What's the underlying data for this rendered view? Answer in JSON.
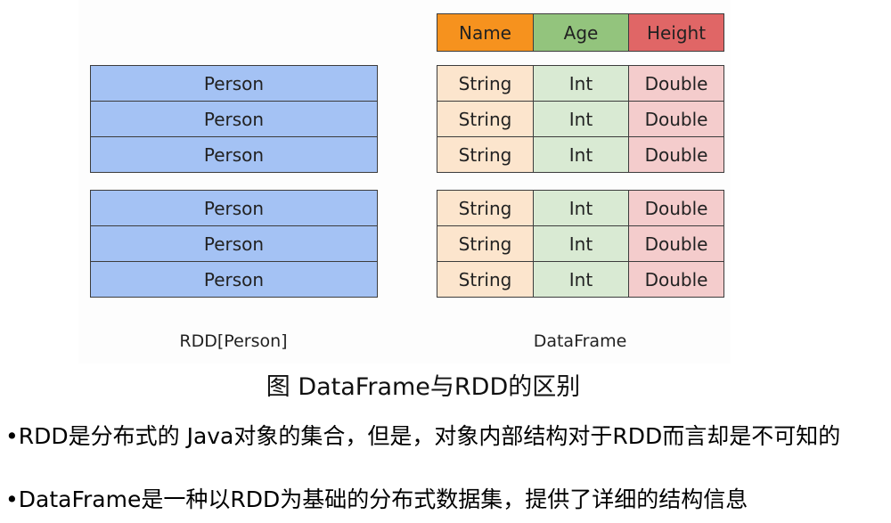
{
  "rdd": {
    "cell_label": "Person",
    "groups": [
      3,
      3
    ],
    "caption": "RDD[Person]"
  },
  "dataframe": {
    "header": [
      "Name",
      "Age",
      "Height"
    ],
    "row_cells": [
      "String",
      "Int",
      "Double"
    ],
    "groups": [
      3,
      3
    ],
    "caption": "DataFrame"
  },
  "colors": {
    "header": [
      "#f6921e",
      "#93c47d",
      "#e06666"
    ],
    "body": [
      "#fce5cd",
      "#d9ead3",
      "#f4cccc"
    ],
    "rdd_cell": "#a4c2f4",
    "border": "#3c3c3c"
  },
  "figure_caption": "图 DataFrame与RDD的区别",
  "bullets": [
    "•RDD是分布式的 Java对象的集合，但是，对象内部结构对于RDD而言却是不可知的",
    "•DataFrame是一种以RDD为基础的分布式数据集，提供了详细的结构信息"
  ]
}
